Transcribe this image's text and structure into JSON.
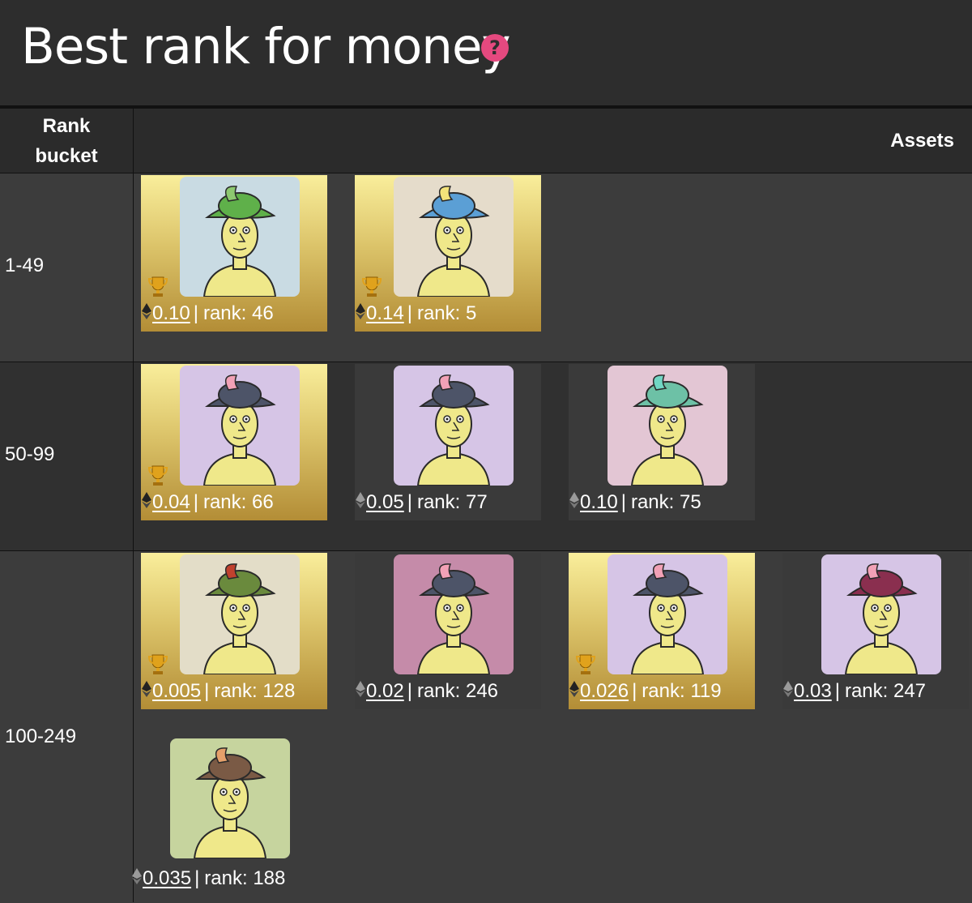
{
  "page": {
    "title": "Best rank for money",
    "help_glyph": "?",
    "help_icon": "question-circle-icon",
    "accent": "#e5497f"
  },
  "table": {
    "headers": {
      "rank_bucket": "Rank\nbucket",
      "assets": "Assets"
    },
    "rows": [
      {
        "bucket": "1-49",
        "assets": [
          {
            "price": "0.10",
            "rank_label": "rank: 46",
            "highlight": true,
            "bg": "#c9dbe3",
            "hat": "#5fb04a",
            "feather": "#8dc870"
          },
          {
            "price": "0.14",
            "rank_label": "rank: 5",
            "highlight": true,
            "bg": "#e5dccb",
            "hat": "#5b9fd5",
            "feather": "#f3e37a"
          }
        ]
      },
      {
        "bucket": "50-99",
        "assets": [
          {
            "price": "0.04",
            "rank_label": "rank: 66",
            "highlight": true,
            "bg": "#d6c5e6",
            "hat": "#4d5468",
            "feather": "#f2a1b6"
          },
          {
            "price": "0.05",
            "rank_label": "rank: 77",
            "highlight": false,
            "bg": "#d6c5e6",
            "hat": "#4d5468",
            "feather": "#f2a1b6"
          },
          {
            "price": "0.10",
            "rank_label": "rank: 75",
            "highlight": false,
            "bg": "#e3c6d4",
            "hat": "#6dc1a6",
            "feather": "#71d6c4"
          }
        ]
      },
      {
        "bucket": "100-249",
        "assets": [
          {
            "price": "0.005",
            "rank_label": "rank: 128",
            "highlight": true,
            "bg": "#e3ddc8",
            "hat": "#6a8a3d",
            "feather": "#c0412e"
          },
          {
            "price": "0.02",
            "rank_label": "rank: 246",
            "highlight": false,
            "bg": "#c58ba9",
            "hat": "#4d5468",
            "feather": "#f2a1b6"
          },
          {
            "price": "0.026",
            "rank_label": "rank: 119",
            "highlight": true,
            "bg": "#d6c5e6",
            "hat": "#4d5468",
            "feather": "#f2a1b6"
          },
          {
            "price": "0.03",
            "rank_label": "rank: 247",
            "highlight": false,
            "bg": "#d6c5e6",
            "hat": "#8a2f4f",
            "feather": "#f2a1b6"
          },
          {
            "price": "0.035",
            "rank_label": "rank: 188",
            "highlight": false,
            "bg": "#c6d49e",
            "hat": "#7a5a45",
            "feather": "#e5a06a"
          }
        ]
      }
    ]
  },
  "icons": {
    "trophy": "trophy-icon",
    "currency": "ethereum-icon"
  }
}
